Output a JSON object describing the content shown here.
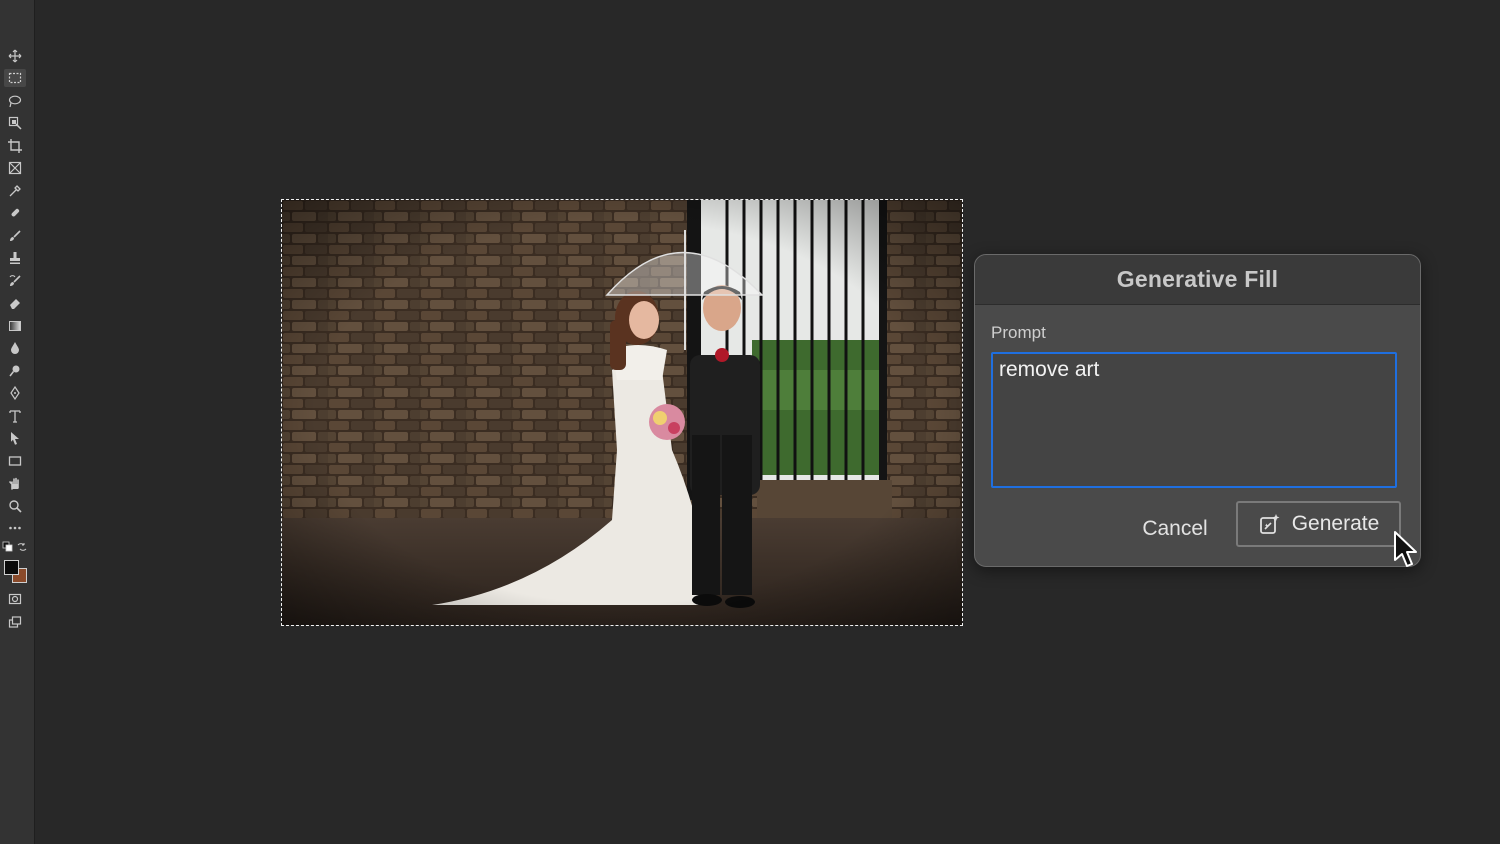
{
  "toolbar": {
    "tools": [
      {
        "name": "move-tool",
        "icon": "move-icon"
      },
      {
        "name": "rectangular-marquee-tool",
        "icon": "marquee-icon",
        "active": true
      },
      {
        "name": "lasso-tool",
        "icon": "lasso-icon"
      },
      {
        "name": "object-selection-tool",
        "icon": "object-selection-icon"
      },
      {
        "name": "crop-tool",
        "icon": "crop-icon"
      },
      {
        "name": "frame-tool",
        "icon": "frame-icon"
      },
      {
        "name": "eyedropper-tool",
        "icon": "eyedropper-icon"
      },
      {
        "name": "spot-healing-tool",
        "icon": "healing-brush-icon"
      },
      {
        "name": "brush-tool",
        "icon": "brush-icon"
      },
      {
        "name": "clone-stamp-tool",
        "icon": "stamp-icon"
      },
      {
        "name": "history-brush-tool",
        "icon": "history-brush-icon"
      },
      {
        "name": "eraser-tool",
        "icon": "eraser-icon"
      },
      {
        "name": "gradient-tool",
        "icon": "gradient-icon"
      },
      {
        "name": "blur-tool",
        "icon": "blur-drop-icon"
      },
      {
        "name": "dodge-tool",
        "icon": "dodge-icon"
      },
      {
        "name": "pen-tool",
        "icon": "pen-icon"
      },
      {
        "name": "type-tool",
        "icon": "type-icon"
      },
      {
        "name": "path-selection-tool",
        "icon": "path-selection-icon"
      },
      {
        "name": "rectangle-tool",
        "icon": "rectangle-icon"
      },
      {
        "name": "hand-tool",
        "icon": "hand-icon"
      },
      {
        "name": "zoom-tool",
        "icon": "zoom-icon"
      },
      {
        "name": "edit-toolbar",
        "icon": "more-icon"
      }
    ],
    "foreground_color": "#0a0a0a",
    "background_color": "#8a4a2a"
  },
  "dialog": {
    "title": "Generative Fill",
    "prompt_label": "Prompt",
    "prompt_value": "remove art",
    "cancel_label": "Cancel",
    "generate_label": "Generate",
    "accent_color": "#1f6fe0"
  }
}
